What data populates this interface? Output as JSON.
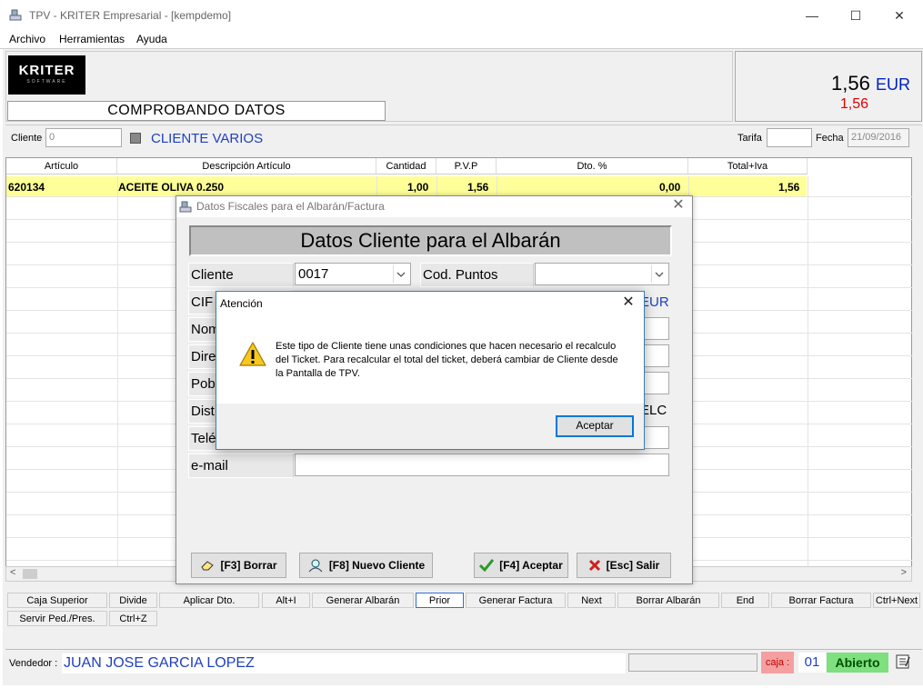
{
  "window": {
    "title": "TPV - KRITER Empresarial -  [kempdemo]",
    "controls": {
      "minimize": "—",
      "maximize": "☐",
      "close": "✕"
    }
  },
  "menu": [
    "Archivo",
    "Herramientas",
    "Ayuda"
  ],
  "header": {
    "logo_line1": "KRITER",
    "logo_line2": "SOFTWARE",
    "status_text": "COMPROBANDO DATOS",
    "total_amount": "1,56",
    "total_currency": "EUR",
    "total_secondary": "1,56"
  },
  "client_row": {
    "cliente_label": "Cliente",
    "cliente_value": "0",
    "varios_label": "CLIENTE VARIOS",
    "tarifa_label": "Tarifa",
    "tarifa_value": "",
    "fecha_label": "Fecha",
    "fecha_value": "21/09/2016"
  },
  "grid": {
    "headers": [
      "Artículo",
      "Descripción Artículo",
      "Cantidad",
      "P.V.P",
      "Dto. %",
      "Total+Iva"
    ],
    "rows": [
      {
        "articulo": "620134",
        "descripcion": "ACEITE OLIVA 0.250",
        "cantidad": "1,00",
        "pvp": "1,56",
        "dto": "0,00",
        "total": "1,56"
      }
    ]
  },
  "toolbar": {
    "row1": [
      "Caja Superior",
      "Divide",
      "Aplicar Dto.",
      "Alt+I",
      "Generar Albarán",
      "Prior",
      "Generar Factura",
      "Next",
      "Borrar Albarán",
      "End",
      "Borrar Factura",
      "Ctrl+Next"
    ],
    "row2": [
      "Servir Ped./Pres.",
      "Ctrl+Z"
    ]
  },
  "status": {
    "vendedor_label": "Vendedor :",
    "vendedor_name": "JUAN JOSE GARCIA LOPEZ",
    "caja_label": "caja :",
    "caja_num": "01",
    "estado": "Abierto"
  },
  "dialog": {
    "title": "Datos Fiscales para el Albarán/Factura",
    "heading": "Datos Cliente para el Albarán",
    "labels": [
      "Cliente",
      "CIF",
      "Nom",
      "Dire",
      "Pob",
      "Dist",
      "Telé",
      "e-mail"
    ],
    "cliente_value": "0017",
    "cod_puntos_label": "Cod. Puntos",
    "cod_puntos_value": "",
    "partial_right_1": "EUR",
    "partial_right_2": "ELC",
    "buttons": {
      "borrar": "[F3] Borrar",
      "nuevo": "[F8] Nuevo Cliente",
      "aceptar": "[F4] Aceptar",
      "salir": "[Esc] Salir"
    }
  },
  "alert": {
    "title": "Atención",
    "message": "Este tipo de Cliente tiene unas condiciones que hacen necesario el recalculo del Ticket. Para recalcular el total del ticket, deberá cambiar de Cliente desde la Pantalla de TPV.",
    "ok_label": "Aceptar"
  },
  "colors": {
    "row_highlight": "#ffff99",
    "accent_blue": "#2040c0",
    "total_red": "#e00000",
    "abierto_green": "#7ee07e",
    "caja_pink": "#f4a0a0"
  }
}
